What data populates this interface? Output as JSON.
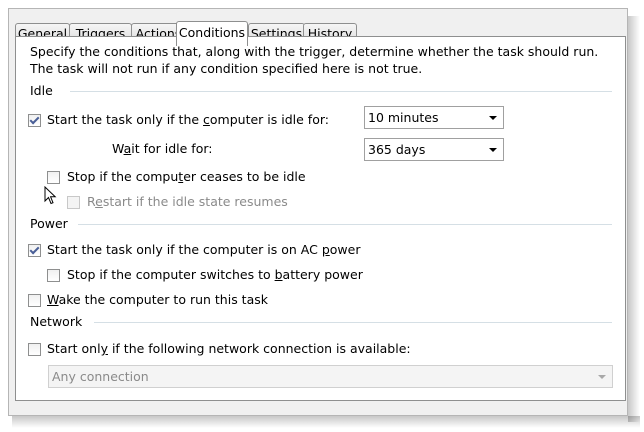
{
  "tabs": [
    {
      "label": "General",
      "active": false
    },
    {
      "label": "Triggers",
      "active": false
    },
    {
      "label": "Actions",
      "active": false
    },
    {
      "label": "Conditions",
      "active": true
    },
    {
      "label": "Settings",
      "active": false
    },
    {
      "label": "History",
      "active": false
    }
  ],
  "description": "Specify the conditions that, along with the trigger, determine whether the task should run.  The task will not run  if any condition specified here is not true.",
  "idle": {
    "section_label": "Idle",
    "start_idle": {
      "before": "Start the task only if the ",
      "accel": "c",
      "after": "omputer is idle for:",
      "checked": true
    },
    "idle_duration": "10 minutes",
    "wait_label": {
      "before": "W",
      "accel": "a",
      "after": "it for idle for:"
    },
    "wait_duration": "365 days",
    "stop_idle": {
      "before": "Stop if the compu",
      "accel": "t",
      "after": "er ceases to be idle",
      "checked": false
    },
    "restart_idle": {
      "before": "R",
      "accel": "e",
      "after": "start if the idle state resumes",
      "checked": false,
      "disabled": true
    }
  },
  "power": {
    "section_label": "Power",
    "ac_power": {
      "before": "Start the task only if the computer is on AC ",
      "accel": "p",
      "after": "ower",
      "checked": true
    },
    "battery": {
      "before": "Stop if the computer switches to ",
      "accel": "b",
      "after": "attery power",
      "checked": false
    },
    "wake": {
      "before": "",
      "accel": "W",
      "after": "ake the computer to run this task",
      "checked": false
    }
  },
  "network": {
    "section_label": "Network",
    "start_only": {
      "before": "Start onl",
      "accel": "y",
      "after": " if the following network connection is available:",
      "checked": false
    },
    "connection": "Any connection"
  }
}
